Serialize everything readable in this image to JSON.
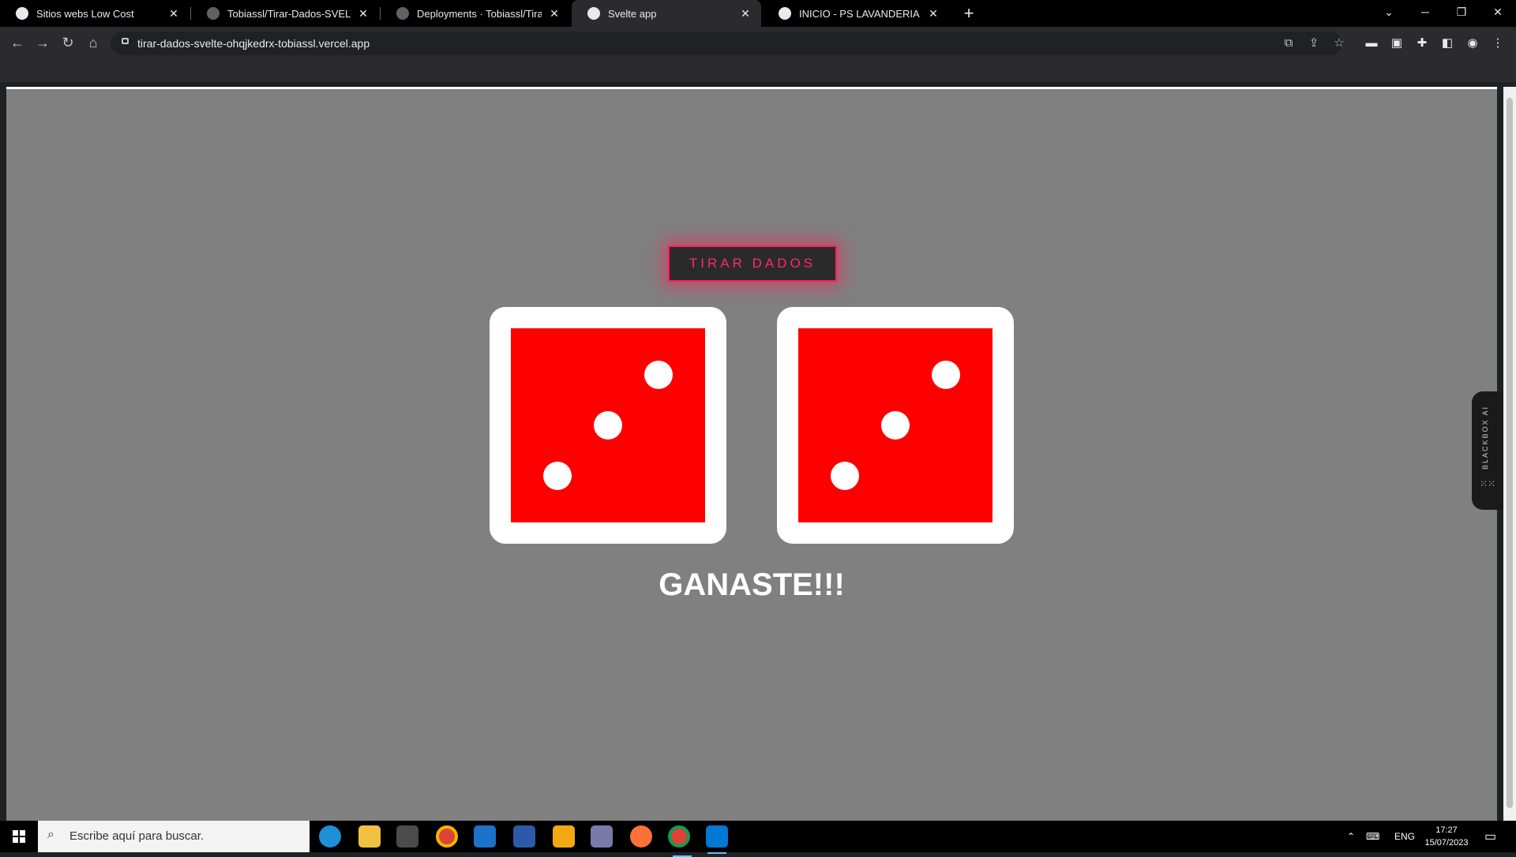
{
  "browser": {
    "tabs": [
      {
        "title": "Sitios webs Low Cost",
        "active": false
      },
      {
        "title": "Tobiassl/Tirar-Dados-SVELTE",
        "active": false
      },
      {
        "title": "Deployments · Tobiassl/Tirar-Dad",
        "active": false
      },
      {
        "title": "Svelte app",
        "active": true
      },
      {
        "title": "INICIO - PS LAVANDERIA",
        "active": false
      }
    ],
    "new_tab_symbol": "+",
    "url": "tirar-dados-svelte-ohqjkedrx-tobiassl.vercel.app"
  },
  "app": {
    "roll_button_label": "TIRAR DADOS",
    "dice": [
      {
        "value": 3,
        "face_color": "#ff0000",
        "pip_color": "#ffffff"
      },
      {
        "value": 3,
        "face_color": "#ff0000",
        "pip_color": "#ffffff"
      }
    ],
    "result_text": "GANASTE!!!",
    "accent_color": "#ff1f5e",
    "background_color": "#808080"
  },
  "sidebar_widget": {
    "label": "BLACKBOX AI"
  },
  "taskbar": {
    "search_placeholder": "Escribe aquí para buscar.",
    "language": "ENG",
    "time": "17:27",
    "date": "15/07/2023",
    "apps": [
      "edge-icon",
      "file-explorer-icon",
      "app-icon",
      "chrome-icon",
      "mail-icon",
      "app-icon",
      "sticky-notes-icon",
      "app-icon",
      "firefox-icon",
      "chrome-icon",
      "vscode-icon"
    ]
  }
}
